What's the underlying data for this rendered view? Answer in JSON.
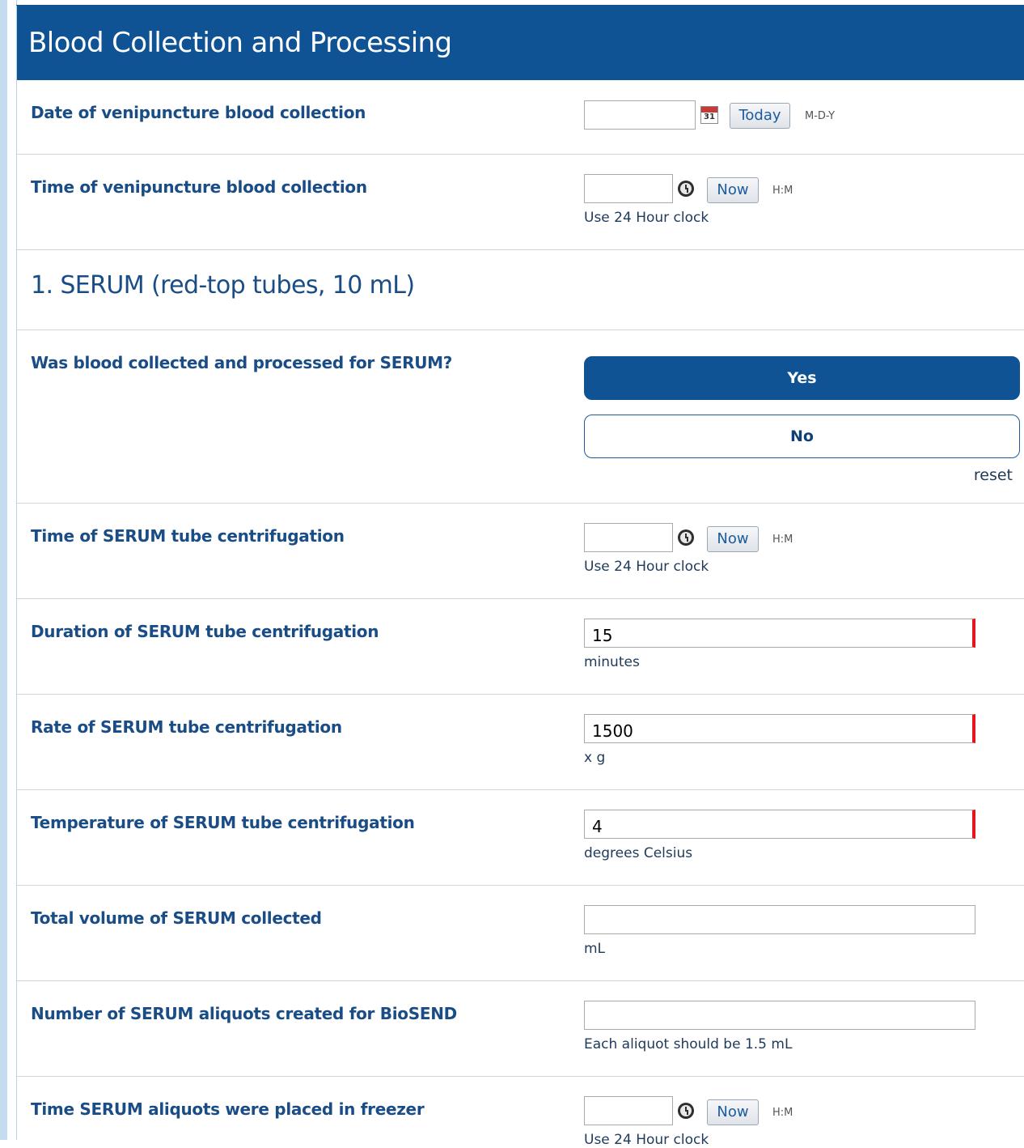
{
  "header": {
    "title": "Blood Collection and Processing"
  },
  "q_date": {
    "label": "Date of venipuncture blood collection",
    "value": "",
    "calendar_day": "31",
    "today_label": "Today",
    "format": "M-D-Y"
  },
  "q_time": {
    "label": "Time of venipuncture blood collection",
    "value": "",
    "now_label": "Now",
    "format": "H:M",
    "note": "Use 24 Hour clock"
  },
  "section_serum": {
    "title": "1. SERUM (red-top tubes, 10 mL)"
  },
  "q_collected": {
    "label": "Was blood collected and processed for SERUM?",
    "options": [
      "Yes",
      "No"
    ],
    "selected": "Yes",
    "reset_label": "reset"
  },
  "q_centrifuge_time": {
    "label": "Time of SERUM tube centrifugation",
    "value": "",
    "now_label": "Now",
    "format": "H:M",
    "note": "Use 24 Hour clock"
  },
  "q_duration": {
    "label": "Duration of SERUM tube centrifugation",
    "value": "15",
    "unit": "minutes"
  },
  "q_rate": {
    "label": "Rate of SERUM tube centrifugation",
    "value": "1500",
    "unit": "x g"
  },
  "q_temperature": {
    "label": "Temperature of SERUM tube centrifugation",
    "value": "4",
    "unit": "degrees Celsius"
  },
  "q_volume": {
    "label": "Total volume of SERUM collected",
    "value": "",
    "unit": "mL"
  },
  "q_aliquots": {
    "label": "Number of SERUM aliquots created for BioSEND",
    "value": "",
    "note": "Each aliquot should be 1.5 mL"
  },
  "q_freezer_time": {
    "label": "Time SERUM aliquots were placed in freezer",
    "value": "",
    "now_label": "Now",
    "format": "H:M",
    "note": "Use 24 Hour clock"
  },
  "colors": {
    "header_bg": "#0f5394",
    "label_text": "#1a4d86",
    "required_marker": "#e8141c"
  }
}
